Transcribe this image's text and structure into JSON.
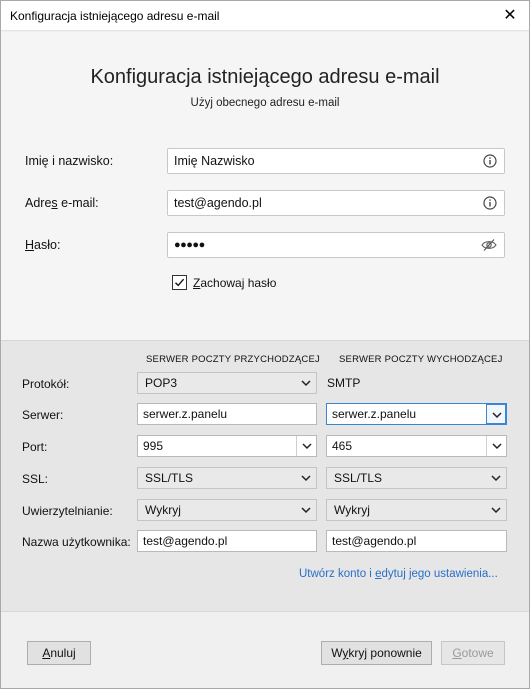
{
  "window": {
    "title": "Konfiguracja istniejącego adresu e-mail",
    "close_glyph": "✕"
  },
  "header": {
    "title": "Konfiguracja istniejącego adresu e-mail",
    "subtitle": "Użyj obecnego adresu e-mail"
  },
  "form": {
    "name_label": "Imię i nazwisko:",
    "name_value": "Imię Nazwisko",
    "email_label_pre": "Adre",
    "email_label_u": "s",
    "email_label_post": " e-mail:",
    "email_value": "test@agendo.pl",
    "password_label_u": "H",
    "password_label_post": "asło:",
    "password_value": "●●●●●",
    "remember_u": "Z",
    "remember_post": "achowaj hasło",
    "remember_checked": true
  },
  "servers": {
    "incoming_header": "SERWER POCZTY PRZYCHODZĄCEJ",
    "outgoing_header": "SERWER POCZTY WYCHODZĄCEJ",
    "rows": {
      "protocol": {
        "label": "Protokół:",
        "incoming": "POP3",
        "outgoing": "SMTP"
      },
      "server": {
        "label": "Serwer:",
        "incoming": "serwer.z.panelu",
        "outgoing": "serwer.z.panelu"
      },
      "port": {
        "label": "Port:",
        "incoming": "995",
        "outgoing": "465"
      },
      "ssl": {
        "label": "SSL:",
        "incoming": "SSL/TLS",
        "outgoing": "SSL/TLS"
      },
      "auth": {
        "label": "Uwierzytelnianie:",
        "incoming": "Wykryj",
        "outgoing": "Wykryj"
      },
      "username": {
        "label": "Nazwa użytkownika:",
        "incoming": "test@agendo.pl",
        "outgoing": "test@agendo.pl"
      }
    },
    "advanced_link_pre": "Utwórz konto i ",
    "advanced_link_u": "e",
    "advanced_link_post": "dytuj jego ustawienia..."
  },
  "footer": {
    "cancel_u": "A",
    "cancel_post": "nuluj",
    "retest_pre": "W",
    "retest_u": "y",
    "retest_post": "kryj ponownie",
    "done_u": "G",
    "done_post": "otowe"
  },
  "colors": {
    "link": "#2a6fc9",
    "focus": "#3a86d6",
    "panel": "#e6e6e6"
  },
  "icons": [
    "info-icon",
    "eye-slash-icon",
    "checkmark-icon",
    "chevron-down-icon",
    "close-icon"
  ]
}
